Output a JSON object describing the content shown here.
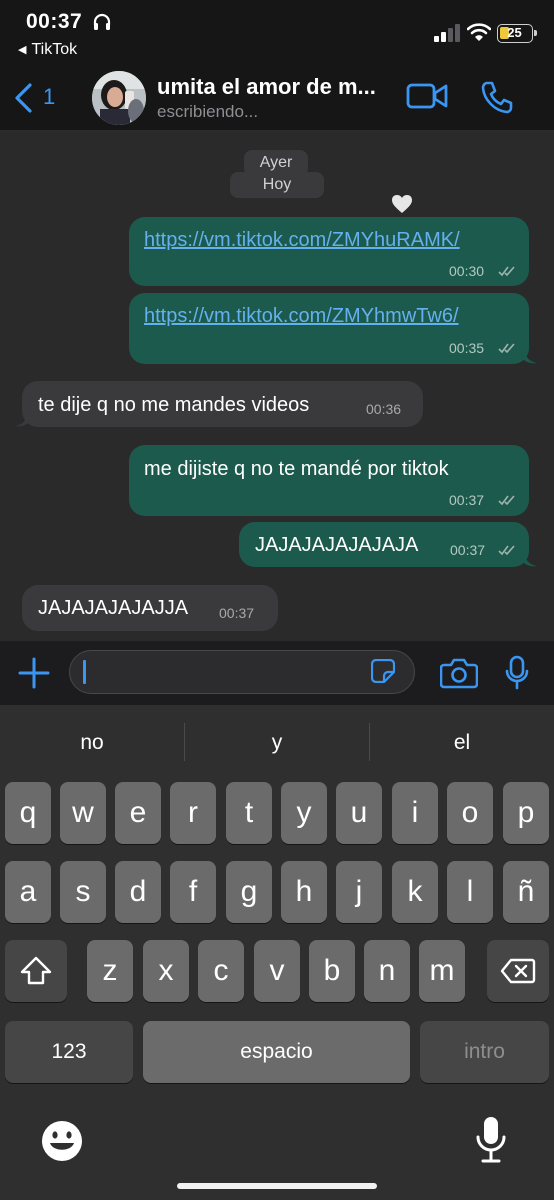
{
  "status_bar": {
    "time": "00:37",
    "back_app": "TikTok",
    "battery": "25"
  },
  "header": {
    "unread_count": "1",
    "contact_name": "umita el amor de m...",
    "contact_status": "escribiendo..."
  },
  "chat": {
    "date_separators": [
      "Ayer",
      "Hoy"
    ],
    "messages": [
      {
        "direction": "out",
        "text": "https://vm.tiktok.com/ZMYhuRAMK/",
        "time": "00:30",
        "is_link": true
      },
      {
        "direction": "out",
        "text": "https://vm.tiktok.com/ZMYhmwTw6/",
        "time": "00:35",
        "is_link": true
      },
      {
        "direction": "in",
        "text": "te dije q no me mandes videos",
        "time": "00:36"
      },
      {
        "direction": "out",
        "text": "me dijiste q no te mandé por tiktok",
        "time": "00:37"
      },
      {
        "direction": "out",
        "text": "JAJAJAJAJAJAJA",
        "time": "00:37"
      },
      {
        "direction": "in",
        "text": "JAJAJAJAJAJJA",
        "time": "00:37"
      }
    ]
  },
  "input": {
    "value": ""
  },
  "keyboard": {
    "suggestions": [
      "no",
      "y",
      "el"
    ],
    "row1": [
      "q",
      "w",
      "e",
      "r",
      "t",
      "y",
      "u",
      "i",
      "o",
      "p"
    ],
    "row2": [
      "a",
      "s",
      "d",
      "f",
      "g",
      "h",
      "j",
      "k",
      "l",
      "ñ"
    ],
    "row3": [
      "z",
      "x",
      "c",
      "v",
      "b",
      "n",
      "m"
    ],
    "numbers_key": "123",
    "space_key": "espacio",
    "return_key": "intro"
  },
  "colors": {
    "outgoing_bubble": "#1b5a4c",
    "incoming_bubble": "#3a3a3c",
    "accent_blue": "#3b96f1",
    "link": "#65b0ee"
  },
  "icons": [
    "headphones-icon",
    "signal-icon",
    "wifi-icon",
    "battery-icon",
    "back-chevron-icon",
    "video-call-icon",
    "phone-icon",
    "heart-reaction-icon",
    "read-ticks-icon",
    "plus-icon",
    "sticker-icon",
    "camera-icon",
    "microphone-icon",
    "shift-icon",
    "backspace-icon",
    "emoji-icon",
    "dictation-icon"
  ]
}
